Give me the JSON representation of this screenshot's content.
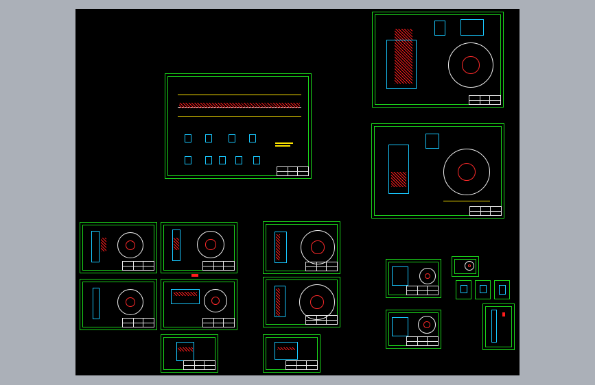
{
  "app": {
    "title": ""
  },
  "viewport": {
    "background": "#000000",
    "frame": "#abb0b8"
  },
  "colors": {
    "border": "#1bd61b",
    "dimension": "#ffe600",
    "hatch": "#ff1c1c",
    "geometry": "#f2f2f2",
    "centerline": "#18c8ff"
  },
  "sheets": [
    {
      "id": "assembly-shaft"
    },
    {
      "id": "pump-housing-top"
    },
    {
      "id": "pump-housing-bottom"
    },
    {
      "id": "impeller-1"
    },
    {
      "id": "impeller-2"
    },
    {
      "id": "disc-1"
    },
    {
      "id": "impeller-3"
    },
    {
      "id": "impeller-4"
    },
    {
      "id": "disc-2"
    },
    {
      "id": "part-small-1"
    },
    {
      "id": "part-small-2"
    },
    {
      "id": "flange-1"
    },
    {
      "id": "flange-2"
    },
    {
      "id": "ring-small"
    },
    {
      "id": "detail-a"
    },
    {
      "id": "detail-b"
    },
    {
      "id": "detail-c"
    },
    {
      "id": "shaft-vertical"
    }
  ]
}
